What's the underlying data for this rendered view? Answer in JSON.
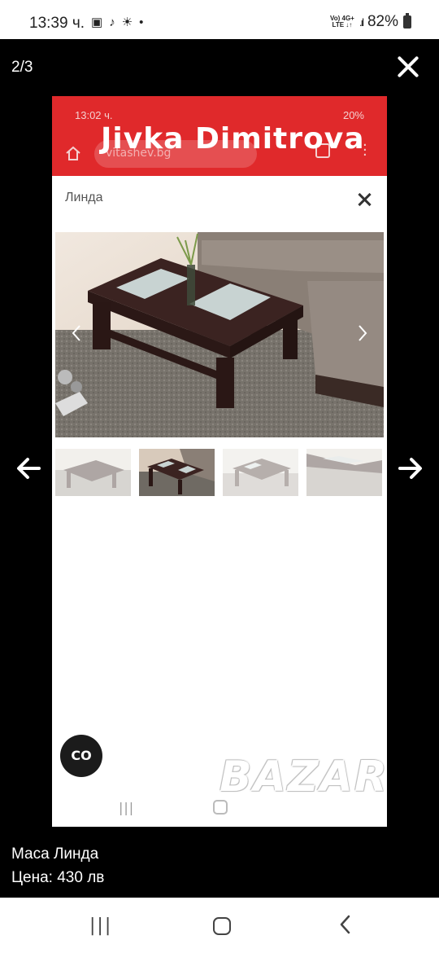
{
  "status_bar": {
    "time": "13:39 ч.",
    "network_top": "Vo) 4G+",
    "network_bottom": "LTE ↓↑",
    "battery": "82%"
  },
  "viewer": {
    "counter": "2/3",
    "close_icon": "close-icon",
    "prev_icon": "arrow-left-icon",
    "next_icon": "arrow-right-icon"
  },
  "inner_screenshot": {
    "status_time": "13:02 ч.",
    "status_battery": "20%",
    "url": "vitashev.bg",
    "overlay_name": "Jivka Dimitrova",
    "gallery_title": "Линда",
    "fab_label": "CO",
    "watermark": "BAZAR",
    "colors": {
      "header": "#e0292b"
    }
  },
  "caption": {
    "title": "Маса Линда",
    "price": "Цена: 430 лв"
  },
  "system_nav": {
    "recents": "|||"
  }
}
